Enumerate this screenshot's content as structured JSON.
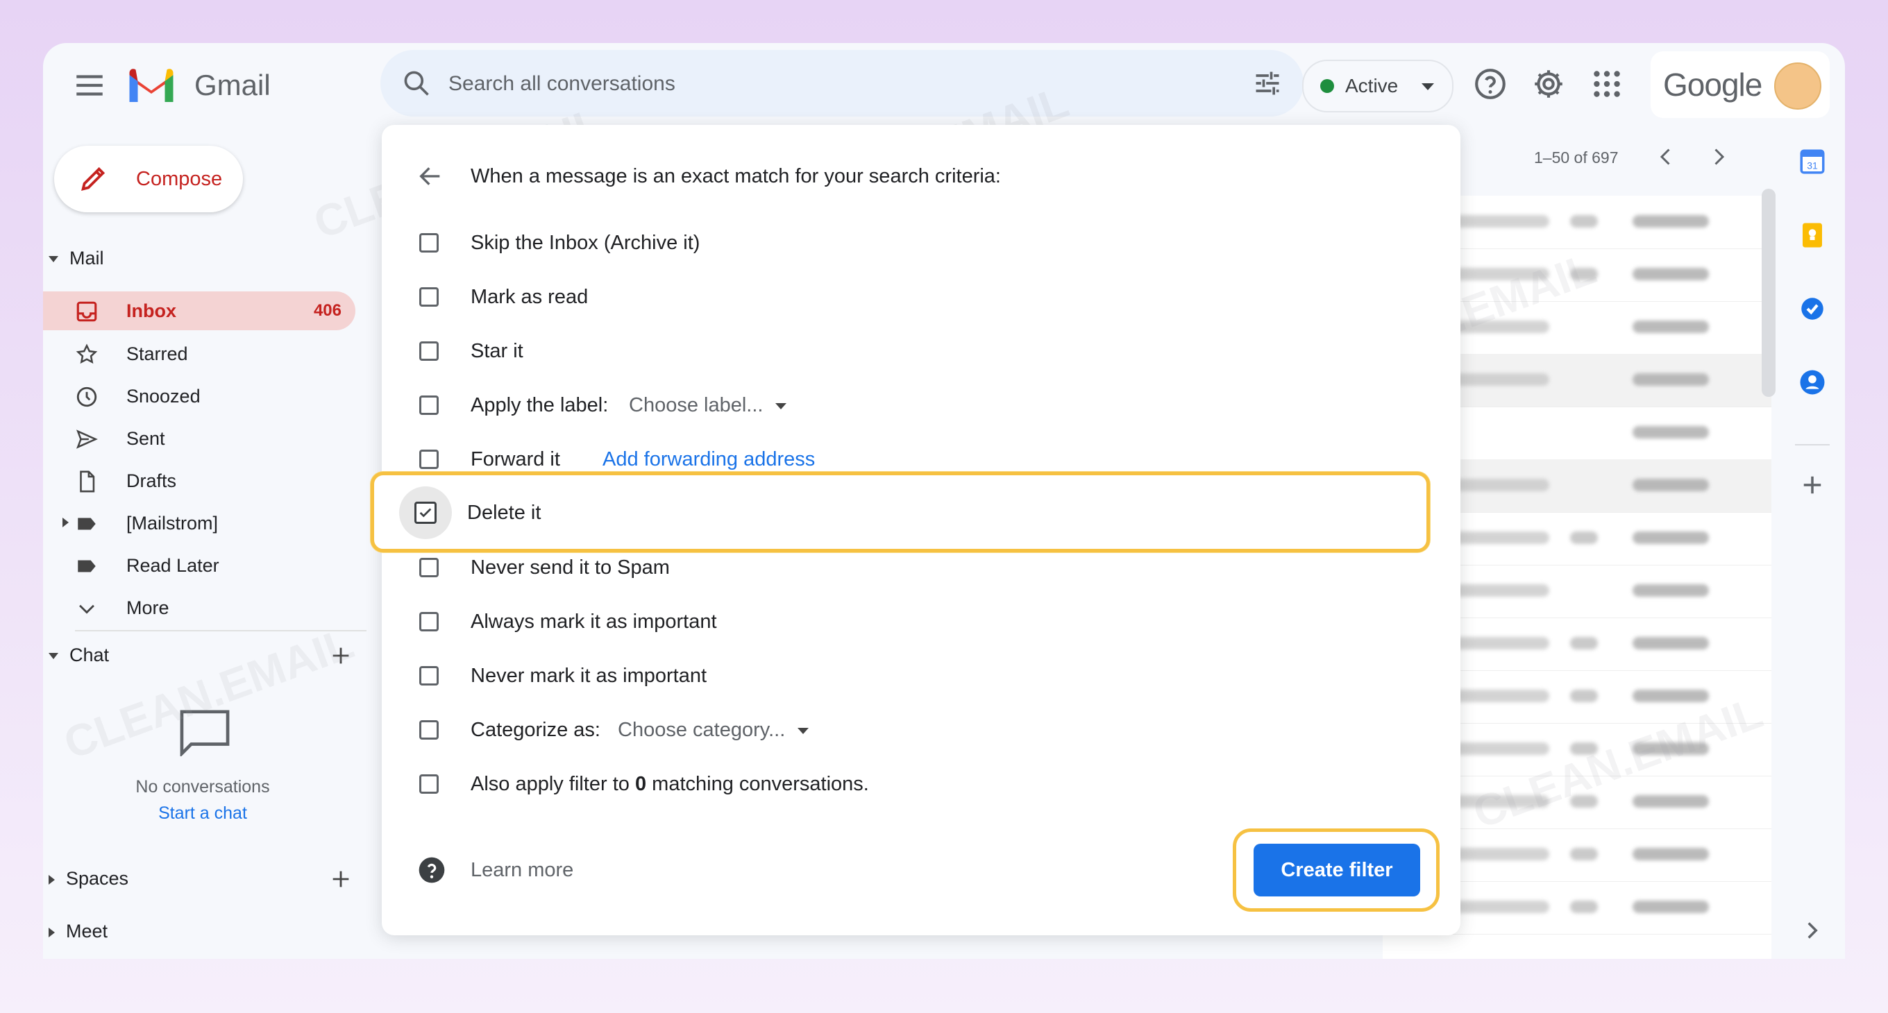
{
  "app": {
    "name": "Gmail"
  },
  "search": {
    "placeholder": "Search all conversations"
  },
  "status": {
    "label": "Active"
  },
  "brand": {
    "google": "Google"
  },
  "compose": {
    "label": "Compose"
  },
  "sidebar": {
    "mail_section": "Mail",
    "items": [
      {
        "label": "Inbox",
        "count": "406"
      },
      {
        "label": "Starred"
      },
      {
        "label": "Snoozed"
      },
      {
        "label": "Sent"
      },
      {
        "label": "Drafts"
      },
      {
        "label": "[Mailstrom]"
      },
      {
        "label": "Read Later"
      },
      {
        "label": "More"
      }
    ],
    "chat_section": "Chat",
    "chat_empty": "No conversations",
    "chat_start": "Start a chat",
    "spaces_section": "Spaces",
    "meet_section": "Meet"
  },
  "pagination": {
    "range": "1–50 of 697"
  },
  "filter_dialog": {
    "title": "When a message is an exact match for your search criteria:",
    "options": [
      {
        "label": "Skip the Inbox (Archive it)",
        "checked": false
      },
      {
        "label": "Mark as read",
        "checked": false
      },
      {
        "label": "Star it",
        "checked": false
      },
      {
        "label": "Apply the label:",
        "select": "Choose label...",
        "checked": false
      },
      {
        "label": "Forward it",
        "link": "Add forwarding address",
        "checked": false
      },
      {
        "label": "Delete it",
        "checked": true
      },
      {
        "label": "Never send it to Spam",
        "checked": false
      },
      {
        "label": "Always mark it as important",
        "checked": false
      },
      {
        "label": "Never mark it as important",
        "checked": false
      },
      {
        "label": "Categorize as:",
        "select": "Choose category...",
        "checked": false
      },
      {
        "label_pre": "Also apply filter to",
        "label_count": "0",
        "label_post": "matching conversations.",
        "checked": false
      }
    ],
    "learn_more": "Learn more",
    "create_button": "Create filter"
  },
  "watermark": "CLEAN.EMAIL",
  "colors": {
    "accent": "#1a73e8",
    "inbox_active": "#f4d3d3",
    "highlight": "#f6c142",
    "brand_red": "#c5221f"
  }
}
